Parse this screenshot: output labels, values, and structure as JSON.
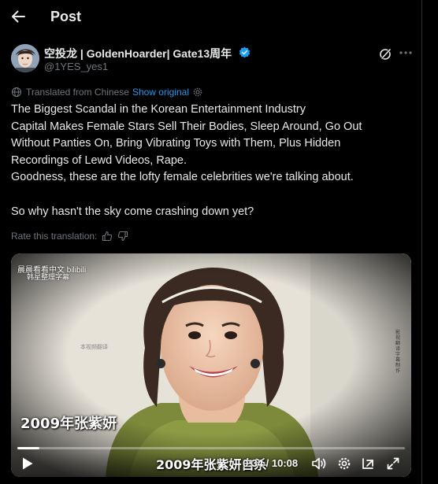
{
  "header": {
    "title": "Post"
  },
  "author": {
    "name": "空投龙 | GoldenHoarder| Gate13周年",
    "handle": "@1YES_yes1"
  },
  "translation": {
    "label": "Translated from Chinese",
    "show_original": "Show original",
    "rate_label": "Rate this translation:"
  },
  "post": {
    "lines": [
      "The Biggest Scandal in the Korean Entertainment Industry",
      "Capital Makes Female Stars Sell Their Bodies, Sleep Around, Go Out",
      "Without Panties On, Bring Vibrating Toys with Them, Plus Hidden",
      "Recordings of Lewd Videos, Rape.",
      "Goodness, these are the lofty female celebrities we're talking about.",
      "So why hasn't the sky come crashing down yet?"
    ]
  },
  "video": {
    "watermark_top": "晨晨看看中文 bilibili",
    "watermark_sub": "韩星整理字幕",
    "watermark_mid": "本视频翻译",
    "watermark_right": "影视翻译字幕制作",
    "caption_left": "2009年张紫妍",
    "caption_bottom": "2009年张紫妍自杀",
    "time_display": "0:34 / 10:08",
    "progress": 0.056
  },
  "colors": {
    "accent": "#1d9bf0",
    "text": "#e7e9ea",
    "muted": "#71767b",
    "background": "#000000"
  },
  "icons": {
    "back": "arrow-left-icon",
    "verified": "verified-badge-icon",
    "grok": "grok-icon",
    "more": "more-dots-icon",
    "globe": "globe-icon",
    "settings": "gear-icon",
    "thumbs_up": "thumbs-up-icon",
    "thumbs_down": "thumbs-down-icon",
    "play": "play-icon",
    "volume": "volume-icon",
    "video_settings": "gear-icon",
    "pip": "picture-in-picture-icon",
    "fullscreen": "fullscreen-icon"
  }
}
